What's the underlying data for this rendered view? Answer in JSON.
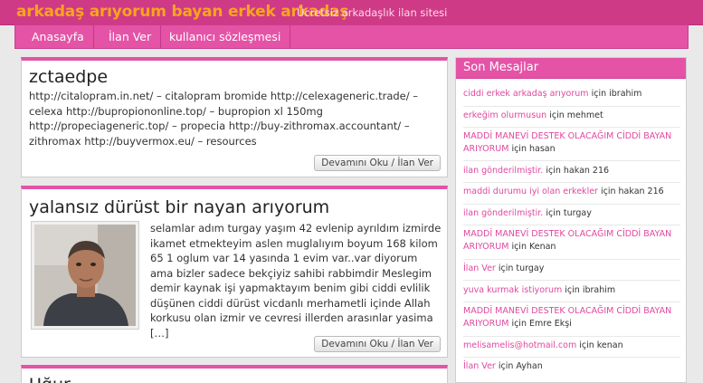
{
  "site": {
    "title": "arkadaş arıyorum bayan erkek arkadaş",
    "tagline": "Ücretsiz arkadaşlık ilan sitesi"
  },
  "nav": [
    {
      "label": "Anasayfa"
    },
    {
      "label": "İlan Ver"
    },
    {
      "label": "kullanıcı sözleşmesi"
    }
  ],
  "posts": [
    {
      "title": "zctaedpe",
      "text": "http://citalopram.in.net/ – citalopram bromide http://celexageneric.trade/ – celexa http://bupropiononline.top/ – bupropion xl 150mg http://propeciageneric.top/ – propecia http://buy-zithromax.accountant/ – zithromax http://buyvermox.eu/ – resources",
      "button": "Devamını Oku / İlan Ver"
    },
    {
      "title": "yalansız dürüst bir nayan arıyorum",
      "text": "selamlar adım turgay yaşım 42 evlenip ayrıldım izmirde ikamet etmekteyim aslen muglalıyım boyum 168 kilom 65 1 oglum var 14 yasında 1 evim var..var diyorum ama bizler sadece bekçiyiz sahibi rabbimdir Meslegim demir kaynak işi yapmaktayım benim gibi ciddi evlilik düşünen ciddi dürüst vicdanlı merhametli içinde Allah korkusu olan izmir ve cevresi illerden arasınlar yasima […]",
      "button": "Devamını Oku / İlan Ver"
    },
    {
      "title": "Uğur"
    }
  ],
  "sidebar": {
    "title": "Son Mesajlar",
    "items": [
      {
        "link": "ciddi erkek arkadaş arıyorum",
        "suffix": " için ibrahim"
      },
      {
        "link": "erkeğim olurmusun",
        "suffix": " için mehmet"
      },
      {
        "link": "MADDİ MANEVİ DESTEK OLACAĞIM CİDDİ BAYAN ARIYORUM",
        "suffix": " için hasan"
      },
      {
        "link": "ilan gönderilmiştir.",
        "suffix": " için hakan 216"
      },
      {
        "link": "maddi durumu iyi olan erkekler",
        "suffix": " için hakan 216"
      },
      {
        "link": "ilan gönderilmiştir.",
        "suffix": " için turgay"
      },
      {
        "link": "MADDİ MANEVİ DESTEK OLACAĞIM CİDDİ BAYAN ARIYORUM",
        "suffix": " için Kenan"
      },
      {
        "link": "İlan Ver",
        "suffix": " için turgay"
      },
      {
        "link": "yuva kurmak istiyorum",
        "suffix": " için ibrahim"
      },
      {
        "link": "MADDİ MANEVİ DESTEK OLACAĞIM CİDDİ BAYAN ARIYORUM",
        "suffix": " için Emre Ekşi"
      },
      {
        "link": "melisamelis@hotmail.com",
        "suffix": " için kenan"
      },
      {
        "link": "İlan Ver",
        "suffix": " için Ayhan"
      }
    ]
  },
  "colors": {
    "accent": "#e453a6",
    "topbar": "#cf3a86",
    "title": "#f7a51c",
    "link": "#e0489e"
  }
}
